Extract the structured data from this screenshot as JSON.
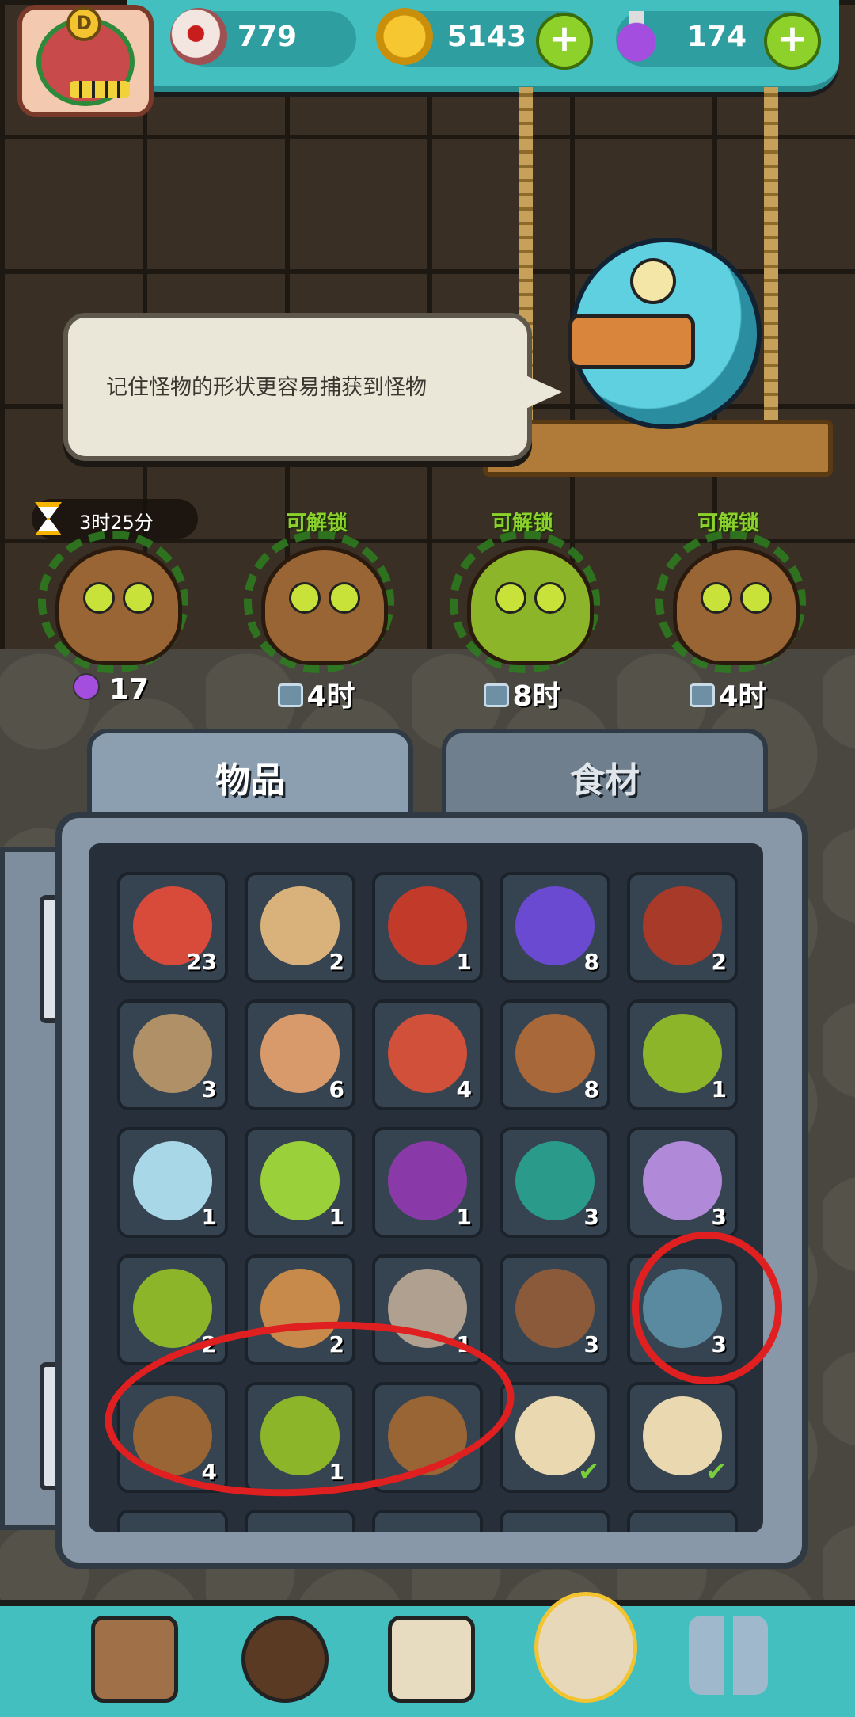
{
  "resources": {
    "eyes": "779",
    "coins": "5143",
    "potions": "174"
  },
  "avatar": {
    "letter": "D"
  },
  "speech": "记住怪物的形状更容易捕获到怪物",
  "slots": [
    {
      "tag": "",
      "timer": "3时25分",
      "bottom": "17",
      "kind": "potion",
      "style": "brown"
    },
    {
      "tag": "可解锁",
      "bottom": "4时",
      "kind": "lock",
      "style": "brown"
    },
    {
      "tag": "可解锁",
      "bottom": "8时",
      "kind": "lock",
      "style": "green"
    },
    {
      "tag": "可解锁",
      "bottom": "4时",
      "kind": "lock",
      "style": "brown"
    }
  ],
  "tabs": {
    "items": "物品",
    "ingredients": "食材"
  },
  "inventory": [
    [
      {
        "name": "bandage-hook",
        "count": "23",
        "color": "#d84a3a"
      },
      {
        "name": "torn-map",
        "count": "2",
        "color": "#d8b27a"
      },
      {
        "name": "oil-barrel",
        "count": "1",
        "color": "#c23a2a"
      },
      {
        "name": "crystal-cluster",
        "count": "8",
        "color": "#6a4ad0"
      },
      {
        "name": "spellbook-ruins",
        "count": "2",
        "color": "#a83a2a"
      }
    ],
    [
      {
        "name": "rope-worm",
        "count": "3",
        "color": "#b09066"
      },
      {
        "name": "club-flail",
        "count": "6",
        "color": "#d89a6a"
      },
      {
        "name": "red-urchin",
        "count": "4",
        "color": "#d0503a"
      },
      {
        "name": "brown-feather",
        "count": "8",
        "color": "#a8683a"
      },
      {
        "name": "yellow-flower-vine",
        "count": "1",
        "color": "#8db52a"
      }
    ],
    [
      {
        "name": "blue-orb",
        "count": "1",
        "color": "#a8d8e8"
      },
      {
        "name": "slime-skull-pot",
        "count": "1",
        "color": "#9ad03a"
      },
      {
        "name": "purple-plant",
        "count": "1",
        "color": "#8a3aa8"
      },
      {
        "name": "teal-leaves",
        "count": "3",
        "color": "#2a9a8a"
      },
      {
        "name": "purple-crystals",
        "count": "3",
        "color": "#b08ad8"
      }
    ],
    [
      {
        "name": "green-pods",
        "count": "2",
        "color": "#8db52a"
      },
      {
        "name": "shell-crab",
        "count": "2",
        "color": "#c88a4a"
      },
      {
        "name": "hermit-shell",
        "count": "1",
        "color": "#b0a090"
      },
      {
        "name": "root-ball",
        "count": "3",
        "color": "#8a5a3a"
      },
      {
        "name": "snail-creature",
        "count": "3",
        "color": "#5a8aa0"
      }
    ],
    [
      {
        "name": "brown-monster",
        "count": "4",
        "color": "#9a6534"
      },
      {
        "name": "green-monster",
        "count": "1",
        "color": "#8db52a"
      },
      {
        "name": "brown-monster-small",
        "count": "",
        "color": "#9a6534"
      },
      {
        "name": "scroll",
        "count": "check",
        "color": "#ead8b0"
      },
      {
        "name": "scroll",
        "count": "check",
        "color": "#ead8b0"
      }
    ]
  ],
  "colors": {
    "accent": "#44bfc0",
    "unlock": "#8ad12b",
    "annotation": "#e02020"
  }
}
